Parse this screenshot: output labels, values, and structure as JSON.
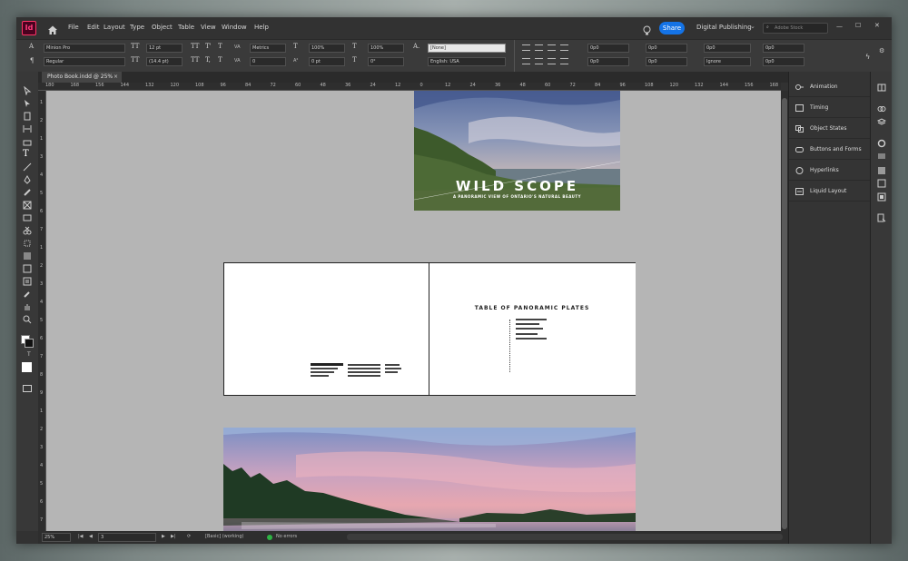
{
  "app": {
    "logo": "Id"
  },
  "menu": [
    "File",
    "Edit",
    "Layout",
    "Type",
    "Object",
    "Table",
    "View",
    "Window",
    "Help"
  ],
  "header": {
    "share": "Share",
    "workspace": "Digital Publishing",
    "search_placeholder": "Adobe Stock"
  },
  "control": {
    "font_family": "Minion Pro",
    "font_style": "Regular",
    "font_size": "12 pt",
    "leading": "(14.4 pt)",
    "kerning": "Metrics",
    "tracking": "0",
    "vscale": "100%",
    "hscale": "100%",
    "baseline": "0 pt",
    "skew": "0°",
    "char_style": "[None]",
    "language": "English: USA",
    "indent_left": "0p0",
    "indent_first": "0p0",
    "space_before": "0p0",
    "indent_right": "0p0",
    "indent_last": "0p0",
    "space_after": "0p0",
    "dropcap_lines": "0p0",
    "dropcap_chars": "0p0",
    "hyph": "Ignore",
    "char_icon": "A.",
    "tt_label": "TT",
    "tsup_label": "T'",
    "tsub_label": "T,",
    "t_label": "T",
    "a_label": "A",
    "para_label": "¶"
  },
  "document": {
    "tab": "Photo Book.indd @ 25%",
    "close": "×"
  },
  "ruler": {
    "h": [
      "180",
      "168",
      "156",
      "144",
      "132",
      "120",
      "108",
      "96",
      "84",
      "72",
      "60",
      "48",
      "36",
      "24",
      "12",
      "0",
      "12",
      "24",
      "36",
      "48",
      "60",
      "72",
      "84",
      "96",
      "108",
      "120",
      "132",
      "144",
      "156",
      "168"
    ],
    "v": [
      "1",
      "2",
      "1",
      "3",
      "4",
      "5",
      "6",
      "7",
      "1",
      "2",
      "3",
      "4",
      "5",
      "6",
      "7",
      "8",
      "9",
      "1",
      "2",
      "3",
      "4",
      "5",
      "6",
      "7"
    ]
  },
  "pages": {
    "cover_title": "WILD SCOPE",
    "cover_subtitle": "A PANORAMIC VIEW OF ONTARIO'S NATURAL BEAUTY",
    "toc_title": "TABLE OF PANORAMIC PLATES"
  },
  "status": {
    "zoom": "25%",
    "page": "3",
    "style": "[Basic] (working)",
    "errors": "No errors"
  },
  "panels": [
    "Animation",
    "Timing",
    "Object States",
    "Buttons and Forms",
    "Hyperlinks",
    "Liquid Layout"
  ],
  "icons": [
    "home-icon",
    "lightbulb-icon",
    "search-icon"
  ],
  "colors": {
    "accent": "#1473e6",
    "brand": "#ff3366",
    "no_errors": "#2fb344"
  }
}
